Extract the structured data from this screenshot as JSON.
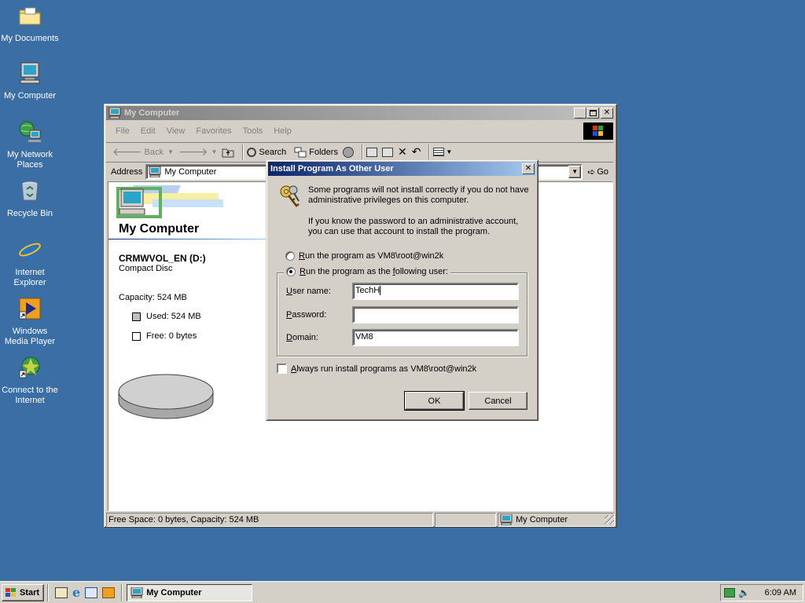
{
  "desktop": {
    "icons": [
      {
        "label": "My Documents"
      },
      {
        "label": "My Computer"
      },
      {
        "label": "My Network Places"
      },
      {
        "label": "Recycle Bin"
      },
      {
        "label": "Internet Explorer"
      },
      {
        "label": "Windows Media Player"
      },
      {
        "label": "Connect to the Internet"
      }
    ]
  },
  "explorer": {
    "title": "My Computer",
    "menu": [
      "File",
      "Edit",
      "View",
      "Favorites",
      "Tools",
      "Help"
    ],
    "toolbar": {
      "back": "Back",
      "search": "Search",
      "folders": "Folders"
    },
    "address": {
      "label": "Address",
      "value": "My Computer",
      "go": "Go"
    },
    "heading": "My Computer",
    "drive": {
      "name": "CRMWVOL_EN (D:)",
      "type": "Compact Disc",
      "capacity": "Capacity: 524 MB",
      "used": "Used: 524 MB",
      "free": "Free: 0 bytes",
      "used_fraction": 1.0
    },
    "status": {
      "left": "Free Space: 0 bytes, Capacity: 524 MB",
      "right": "My Computer"
    }
  },
  "dialog": {
    "title": "Install Program As Other User",
    "message1": "Some programs will not install correctly if you do not have administrative privileges on this computer.",
    "message2": "If you know the password to an administrative account, you can use that account to install the program.",
    "radio_current": {
      "prefix": "R",
      "rest": "un the program as VM8\\root@win2k",
      "selected": false
    },
    "radio_other": {
      "prefix": "R",
      "rest": "un the program as the ",
      "underline": "f",
      "rest2": "ollowing user:",
      "selected": true
    },
    "username": {
      "label_u": "U",
      "label_rest": "ser name:",
      "value": "TechH"
    },
    "password": {
      "label_u": "P",
      "label_rest": "assword:",
      "value": ""
    },
    "domain": {
      "label_u": "D",
      "label_rest": "omain:",
      "value": "VM8"
    },
    "always": {
      "prefix": "A",
      "rest": "lways run install programs as VM8\\root@win2k",
      "checked": false
    },
    "ok": "OK",
    "cancel": "Cancel"
  },
  "taskbar": {
    "start": "Start",
    "task": "My Computer",
    "time": "6:09 AM"
  },
  "colors": {
    "desktop": "#3a6ea5",
    "title_active": "#0a246a",
    "face": "#d4d0c8"
  }
}
